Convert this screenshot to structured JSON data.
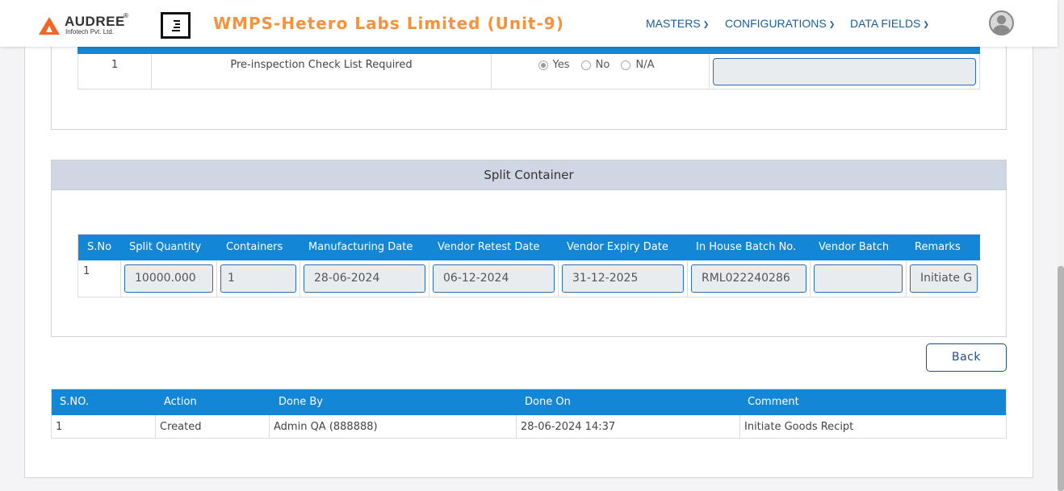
{
  "header": {
    "brand": "AUDREE",
    "brand_mark": "®",
    "brand_sub": "Infotech Pvt. Ltd.",
    "app_title": "WMPS-Hetero Labs Limited (Unit-9)",
    "nav": [
      {
        "label": "MASTERS"
      },
      {
        "label": "CONFIGURATIONS"
      },
      {
        "label": "DATA FIELDS"
      }
    ],
    "icons": {
      "menu": "menu-toggle-icon",
      "avatar": "user-avatar-icon",
      "chevron": "chevron-down-icon"
    }
  },
  "checklist": {
    "row": {
      "sno": "1",
      "item": "Pre-inspection Check List Required",
      "options": [
        "Yes",
        "No",
        "N/A"
      ],
      "selected": "Yes",
      "remarks": ""
    }
  },
  "split_container": {
    "title": "Split Container",
    "columns": [
      "S.No",
      "Split Quantity",
      "Containers",
      "Manufacturing Date",
      "Vendor Retest Date",
      "Vendor Expiry Date",
      "In House Batch No.",
      "Vendor Batch",
      "Remarks"
    ],
    "row": {
      "sno": "1",
      "split_quantity": "10000.000",
      "containers": "1",
      "manufacturing_date": "28-06-2024",
      "vendor_retest_date": "06-12-2024",
      "vendor_expiry_date": "31-12-2025",
      "in_house_batch_no": "RML022240286",
      "vendor_batch": "",
      "remarks": "Initiate G"
    }
  },
  "actions": {
    "back_label": "Back"
  },
  "audit": {
    "columns": [
      "S.NO.",
      "Action",
      "Done By",
      "Done On",
      "Comment"
    ],
    "rows": [
      {
        "sno": "1",
        "action": "Created",
        "done_by": "Admin QA (888888)",
        "done_on": "28-06-2024 14:37",
        "comment": "Initiate Goods Recipt"
      }
    ]
  },
  "colors": {
    "accent": "#1386d6",
    "title": "#f5923e",
    "nav": "#1a5ea0",
    "panel_head": "#cfd7e5"
  }
}
